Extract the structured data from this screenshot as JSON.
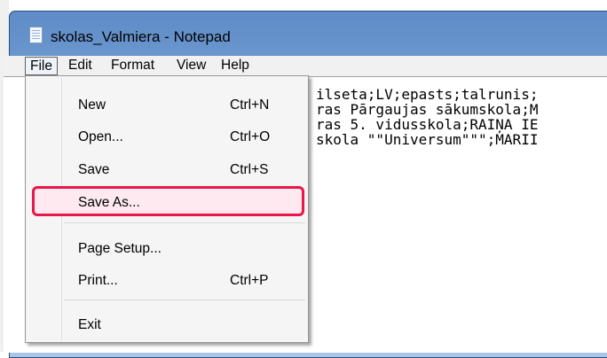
{
  "window": {
    "title": "skolas_Valmiera - Notepad",
    "icon": "notepad-icon"
  },
  "menubar": {
    "items": [
      "File",
      "Edit",
      "Format",
      "View",
      "Help"
    ]
  },
  "file_menu": {
    "new_label": "New",
    "new_shortcut": "Ctrl+N",
    "open_label": "Open...",
    "open_shortcut": "Ctrl+O",
    "save_label": "Save",
    "save_shortcut": "Ctrl+S",
    "saveas_label": "Save As...",
    "pagesetup_label": "Page Setup...",
    "print_label": "Print...",
    "print_shortcut": "Ctrl+P",
    "exit_label": "Exit"
  },
  "editor": {
    "lines": [
      "ilseta;LV;epasts;talrunis;",
      "ras Pārgaujas sākumskola;M",
      "ras 5. vidusskola;RAIŅA IE",
      "skola \"\"Universum\"\"\";MARII"
    ]
  },
  "colors": {
    "highlight_border": "#e8174a",
    "titlebar": "#7ea6d8"
  }
}
